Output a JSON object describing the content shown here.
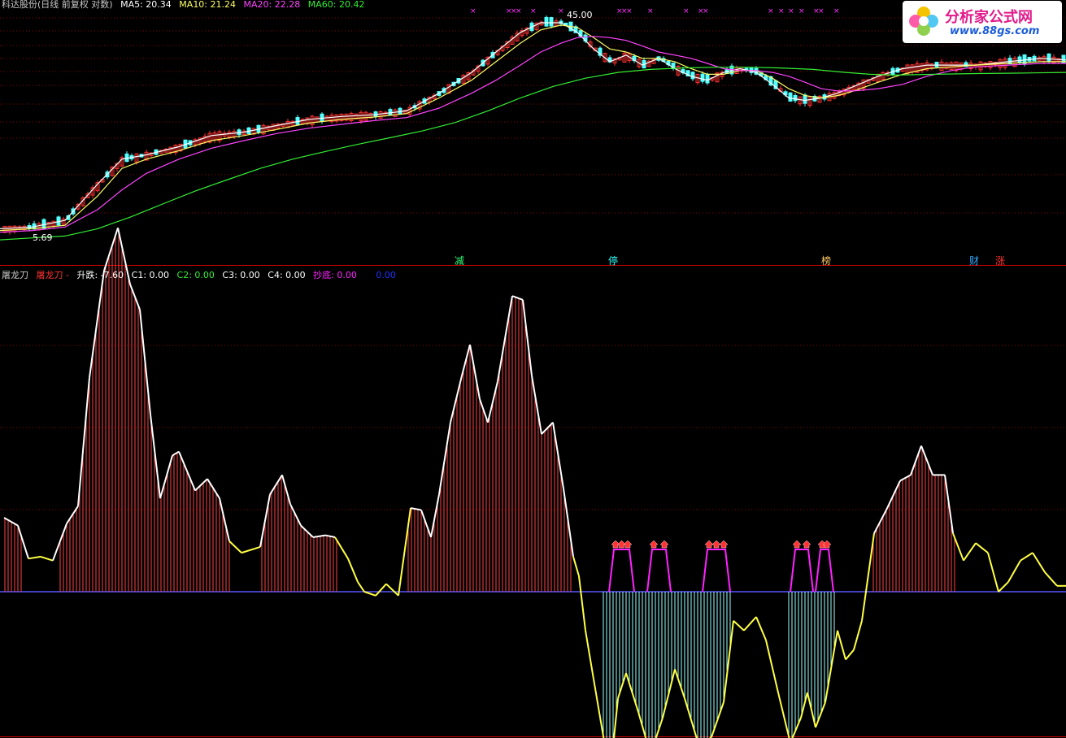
{
  "header_top": {
    "title": "科达股份(日线 前复权 对数)",
    "ma5": "MA5: 20.34",
    "ma10": "MA10: 21.24",
    "ma20": "MA20: 22.28",
    "ma60": "MA60: 20.42"
  },
  "header_bottom": {
    "indicator": "屠龙刀",
    "series1": "屠龙刀 -",
    "rise_fall": "升跌: -7.60",
    "c1": "C1: 0.00",
    "c2": "C2: 0.00",
    "c3": "C3: 0.00",
    "c4": "C4: 0.00",
    "bottom_fish": "抄底: 0.00",
    "extra": "0.00"
  },
  "colors": {
    "ma5": "#ffffff",
    "ma10": "#ffff66",
    "ma20": "#ff44ff",
    "ma60": "#33ee33",
    "indicator_line_pos": "#ffffff",
    "indicator_line_neg": "#ffff44",
    "bars_pos": "#ff4444",
    "bars_neg": "#99ffff",
    "signal": "#ff22ff",
    "zero_line": "#5555ff",
    "grid": "#880000"
  },
  "price_labels": {
    "high": "45.00",
    "low": "5.69"
  },
  "event_tags": [
    {
      "text": "减",
      "color": "#33ff77"
    },
    {
      "text": "停",
      "color": "#33ffff"
    },
    {
      "text": "榜",
      "color": "#ffcc66"
    },
    {
      "text": "财",
      "color": "#33aaff"
    },
    {
      "text": "涨",
      "color": "#ff3333"
    }
  ],
  "watermark": {
    "name": "分析家公式网",
    "url": "www.88gs.com"
  },
  "chart_data": [
    {
      "type": "line",
      "panel": "price",
      "title": "科达股份(日线 前复权 对数)",
      "series": [
        {
          "name": "MA5",
          "points": [
            [
              0,
              5.8
            ],
            [
              40,
              5.9
            ],
            [
              80,
              6.3
            ],
            [
              120,
              9.0
            ],
            [
              150,
              11.5
            ],
            [
              180,
              12.0
            ],
            [
              220,
              13.0
            ],
            [
              260,
              14.5
            ],
            [
              300,
              15.0
            ],
            [
              340,
              16.0
            ],
            [
              380,
              17.0
            ],
            [
              420,
              17.5
            ],
            [
              460,
              17.8
            ],
            [
              500,
              18.5
            ],
            [
              540,
              22
            ],
            [
              580,
              27
            ],
            [
              610,
              33
            ],
            [
              640,
              40
            ],
            [
              665,
              44
            ],
            [
              690,
              44
            ],
            [
              710,
              40
            ],
            [
              730,
              34
            ],
            [
              750,
              30
            ],
            [
              770,
              32
            ],
            [
              790,
              29
            ],
            [
              810,
              31
            ],
            [
              830,
              28
            ],
            [
              850,
              26
            ],
            [
              870,
              25
            ],
            [
              890,
              27
            ],
            [
              910,
              28
            ],
            [
              930,
              27
            ],
            [
              950,
              24
            ],
            [
              970,
              21
            ],
            [
              990,
              20.5
            ],
            [
              1010,
              21
            ],
            [
              1030,
              22
            ],
            [
              1050,
              23.5
            ],
            [
              1080,
              26
            ],
            [
              1110,
              28
            ],
            [
              1140,
              29
            ],
            [
              1170,
              29
            ],
            [
              1200,
              29
            ],
            [
              1240,
              30
            ],
            [
              1280,
              31
            ],
            [
              1311,
              30.5
            ]
          ]
        },
        {
          "name": "MA10",
          "points": [
            [
              0,
              5.7
            ],
            [
              40,
              5.8
            ],
            [
              80,
              6.0
            ],
            [
              120,
              8.0
            ],
            [
              150,
              10.5
            ],
            [
              180,
              11.5
            ],
            [
              220,
              12.5
            ],
            [
              260,
              13.8
            ],
            [
              300,
              14.5
            ],
            [
              340,
              15.4
            ],
            [
              380,
              16.4
            ],
            [
              420,
              17.0
            ],
            [
              460,
              17.4
            ],
            [
              500,
              18.0
            ],
            [
              540,
              21
            ],
            [
              580,
              25
            ],
            [
              610,
              30
            ],
            [
              640,
              36
            ],
            [
              665,
              41
            ],
            [
              690,
              43
            ],
            [
              710,
              42
            ],
            [
              730,
              38
            ],
            [
              750,
              34
            ],
            [
              770,
              33
            ],
            [
              790,
              31
            ],
            [
              810,
              31
            ],
            [
              830,
              30
            ],
            [
              850,
              28
            ],
            [
              870,
              26.5
            ],
            [
              890,
              26.5
            ],
            [
              910,
              27.5
            ],
            [
              930,
              27.5
            ],
            [
              950,
              25.5
            ],
            [
              970,
              23
            ],
            [
              990,
              21.5
            ],
            [
              1010,
              21
            ],
            [
              1030,
              21.5
            ],
            [
              1050,
              22.5
            ],
            [
              1080,
              24.5
            ],
            [
              1110,
              26.5
            ],
            [
              1140,
              28
            ],
            [
              1170,
              28.5
            ],
            [
              1200,
              29
            ],
            [
              1240,
              29.5
            ],
            [
              1280,
              30
            ],
            [
              1311,
              30
            ]
          ]
        },
        {
          "name": "MA20",
          "points": [
            [
              0,
              5.6
            ],
            [
              40,
              5.7
            ],
            [
              80,
              5.9
            ],
            [
              120,
              7.0
            ],
            [
              150,
              8.5
            ],
            [
              180,
              10.0
            ],
            [
              220,
              11.5
            ],
            [
              260,
              12.8
            ],
            [
              300,
              13.8
            ],
            [
              340,
              14.8
            ],
            [
              380,
              15.6
            ],
            [
              420,
              16.2
            ],
            [
              460,
              16.8
            ],
            [
              500,
              17.3
            ],
            [
              540,
              19
            ],
            [
              580,
              22
            ],
            [
              610,
              25
            ],
            [
              640,
              29
            ],
            [
              665,
              33
            ],
            [
              690,
              36
            ],
            [
              710,
              38
            ],
            [
              730,
              38.5
            ],
            [
              750,
              38
            ],
            [
              770,
              37
            ],
            [
              790,
              35
            ],
            [
              810,
              33
            ],
            [
              830,
              32
            ],
            [
              850,
              31
            ],
            [
              870,
              29.5
            ],
            [
              890,
              28
            ],
            [
              910,
              27.5
            ],
            [
              930,
              27.5
            ],
            [
              950,
              27
            ],
            [
              970,
              26
            ],
            [
              990,
              24.5
            ],
            [
              1010,
              23
            ],
            [
              1030,
              22.5
            ],
            [
              1050,
              22.5
            ],
            [
              1080,
              23
            ],
            [
              1110,
              24
            ],
            [
              1140,
              26
            ],
            [
              1170,
              27.5
            ],
            [
              1200,
              28.5
            ],
            [
              1240,
              29
            ],
            [
              1280,
              29.5
            ],
            [
              1311,
              29.5
            ]
          ]
        },
        {
          "name": "MA60",
          "points": [
            [
              0,
              5.2
            ],
            [
              40,
              5.3
            ],
            [
              80,
              5.4
            ],
            [
              120,
              5.8
            ],
            [
              160,
              6.5
            ],
            [
              200,
              7.4
            ],
            [
              240,
              8.4
            ],
            [
              280,
              9.4
            ],
            [
              320,
              10.5
            ],
            [
              360,
              11.5
            ],
            [
              400,
              12.4
            ],
            [
              440,
              13.3
            ],
            [
              480,
              14.2
            ],
            [
              520,
              15.2
            ],
            [
              560,
              16.5
            ],
            [
              600,
              18.5
            ],
            [
              640,
              21
            ],
            [
              680,
              23.5
            ],
            [
              720,
              25.5
            ],
            [
              760,
              27
            ],
            [
              800,
              27.8
            ],
            [
              840,
              28.2
            ],
            [
              880,
              28.4
            ],
            [
              920,
              28.4
            ],
            [
              960,
              28.2
            ],
            [
              1000,
              27.8
            ],
            [
              1040,
              27
            ],
            [
              1070,
              26.5
            ],
            [
              1100,
              26.3
            ],
            [
              1150,
              26.5
            ],
            [
              1200,
              26.7
            ],
            [
              1250,
              26.8
            ],
            [
              1311,
              27
            ]
          ]
        }
      ],
      "ylim": [
        5,
        50
      ],
      "log_scale": true,
      "annotations": [
        "45.00",
        "5.69"
      ]
    },
    {
      "type": "area",
      "panel": "indicator",
      "title": "屠龙刀",
      "zero": 0,
      "ylim": [
        -70,
        160
      ],
      "series": [
        {
          "name": "屠龙刀",
          "points": [
            [
              5,
              38
            ],
            [
              22,
              34
            ],
            [
              35,
              17
            ],
            [
              50,
              18
            ],
            [
              65,
              16
            ],
            [
              82,
              35
            ],
            [
              96,
              44
            ],
            [
              110,
              110
            ],
            [
              128,
              165
            ],
            [
              145,
              187
            ],
            [
              160,
              158
            ],
            [
              172,
              145
            ],
            [
              185,
              91
            ],
            [
              197,
              48
            ],
            [
              212,
              70
            ],
            [
              220,
              72
            ],
            [
              240,
              52
            ],
            [
              255,
              58
            ],
            [
              270,
              48
            ],
            [
              282,
              26
            ],
            [
              297,
              20
            ],
            [
              320,
              23
            ],
            [
              332,
              50
            ],
            [
              347,
              60
            ],
            [
              357,
              45
            ],
            [
              370,
              34
            ],
            [
              385,
              28
            ],
            [
              400,
              29
            ],
            [
              412,
              28
            ],
            [
              428,
              17
            ],
            [
              440,
              5
            ],
            [
              448,
              0
            ],
            [
              462,
              -2
            ],
            [
              475,
              4
            ],
            [
              490,
              -2
            ],
            [
              505,
              43
            ],
            [
              518,
              42
            ],
            [
              530,
              28
            ],
            [
              540,
              50
            ],
            [
              554,
              87
            ],
            [
              568,
              111
            ],
            [
              578,
              127
            ],
            [
              590,
              99
            ],
            [
              600,
              87
            ],
            [
              612,
              108
            ],
            [
              630,
              152
            ],
            [
              643,
              150
            ],
            [
              654,
              111
            ],
            [
              666,
              81
            ],
            [
              680,
              87
            ],
            [
              693,
              53
            ],
            [
              705,
              18
            ],
            [
              712,
              8
            ],
            [
              720,
              -20
            ],
            [
              730,
              -45
            ],
            [
              745,
              -82
            ],
            [
              752,
              -88
            ],
            [
              760,
              -55
            ],
            [
              770,
              -42
            ],
            [
              785,
              -62
            ],
            [
              800,
              -84
            ],
            [
              815,
              -65
            ],
            [
              830,
              -40
            ],
            [
              842,
              -55
            ],
            [
              860,
              -80
            ],
            [
              875,
              -75
            ],
            [
              890,
              -57
            ],
            [
              902,
              -15
            ],
            [
              915,
              -20
            ],
            [
              930,
              -13
            ],
            [
              942,
              -25
            ],
            [
              957,
              -52
            ],
            [
              972,
              -78
            ],
            [
              985,
              -65
            ],
            [
              993,
              -52
            ],
            [
              1003,
              -70
            ],
            [
              1015,
              -57
            ],
            [
              1030,
              -20
            ],
            [
              1040,
              -35
            ],
            [
              1050,
              -30
            ],
            [
              1060,
              -15
            ],
            [
              1075,
              30
            ],
            [
              1090,
              42
            ],
            [
              1107,
              57
            ],
            [
              1120,
              60
            ],
            [
              1133,
              75
            ],
            [
              1147,
              60
            ],
            [
              1162,
              60
            ],
            [
              1172,
              30
            ],
            [
              1185,
              16
            ],
            [
              1200,
              25
            ],
            [
              1215,
              20
            ],
            [
              1228,
              0
            ],
            [
              1240,
              5
            ],
            [
              1255,
              16
            ],
            [
              1270,
              20
            ],
            [
              1285,
              10
            ],
            [
              1300,
              3
            ],
            [
              1311,
              3
            ]
          ]
        }
      ],
      "signal_markers_count": 5
    }
  ]
}
